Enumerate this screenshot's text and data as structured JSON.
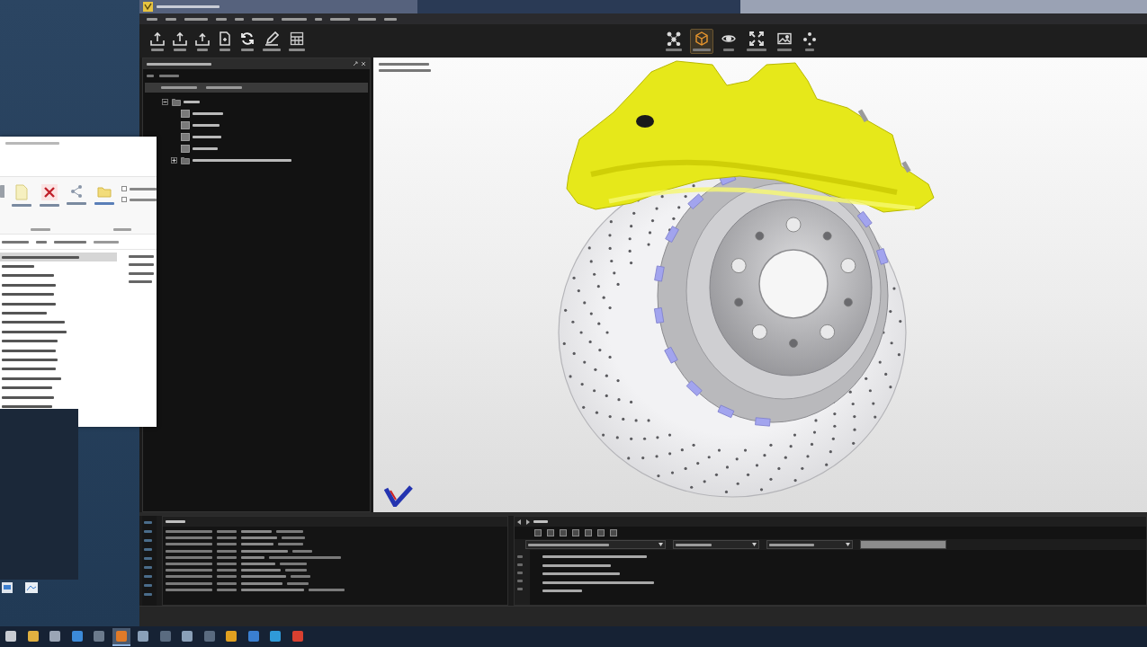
{
  "file_explorer": {
    "files": [
      {
        "selected": true
      },
      {
        "selected": false
      },
      {
        "selected": false
      },
      {
        "selected": false
      },
      {
        "selected": false
      },
      {
        "selected": false
      },
      {
        "selected": false
      },
      {
        "selected": false
      },
      {
        "selected": false
      },
      {
        "selected": false
      },
      {
        "selected": false
      },
      {
        "selected": false
      },
      {
        "selected": false
      },
      {
        "selected": false
      },
      {
        "selected": false
      },
      {
        "selected": false
      },
      {
        "selected": false
      }
    ]
  },
  "toolbar": {
    "right_buttons": [
      {
        "selected": false
      },
      {
        "selected": true
      },
      {
        "selected": false
      },
      {
        "selected": false
      },
      {
        "selected": false
      },
      {
        "selected": false
      }
    ]
  },
  "tree": {
    "items": [
      {
        "kind": "group",
        "expanded": true,
        "children": [
          {
            "kind": "part"
          },
          {
            "kind": "part"
          },
          {
            "kind": "part"
          },
          {
            "kind": "part"
          },
          {
            "kind": "group",
            "expanded": false
          }
        ]
      }
    ]
  },
  "taskbar": {
    "apps": [
      {
        "active": false,
        "color": "#c8ccd2"
      },
      {
        "active": false,
        "color": "#e0b040"
      },
      {
        "active": false,
        "color": "#9aa5b5"
      },
      {
        "active": false,
        "color": "#3c8ad8"
      },
      {
        "active": false,
        "color": "#6b7a8c"
      },
      {
        "active": true,
        "color": "#e07a28"
      },
      {
        "active": false,
        "color": "#8aa0b8"
      },
      {
        "active": false,
        "color": "#5a6b80"
      },
      {
        "active": false,
        "color": "#8aa0b8"
      },
      {
        "active": false,
        "color": "#5a6b80"
      },
      {
        "active": false,
        "color": "#e0a020"
      },
      {
        "active": false,
        "color": "#3a7fd0"
      },
      {
        "active": false,
        "color": "#2f9ad8"
      },
      {
        "active": false,
        "color": "#d84030"
      }
    ]
  }
}
